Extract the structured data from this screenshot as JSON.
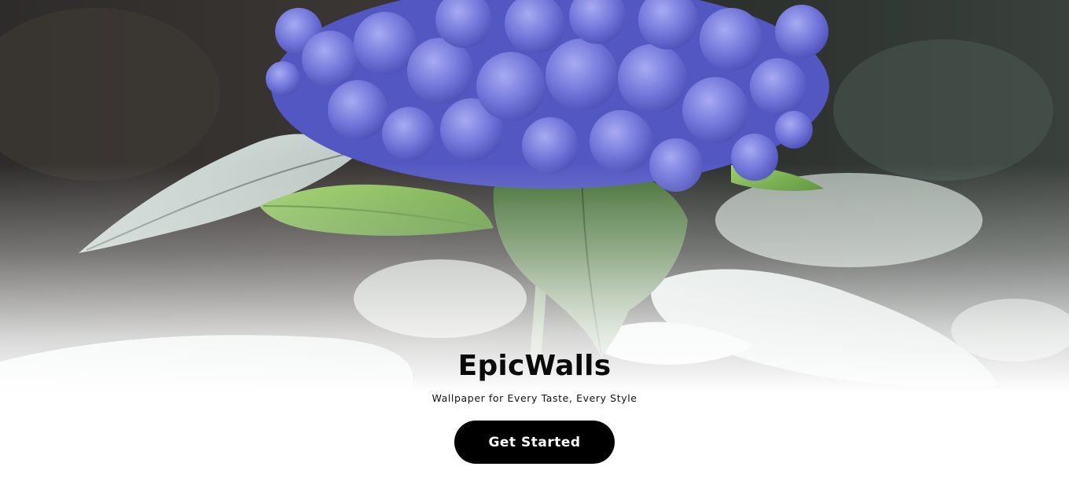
{
  "hero": {
    "title": "EpicWalls",
    "tagline": "Wallpaper for Every Taste, Every Style",
    "cta_label": "Get Started"
  }
}
